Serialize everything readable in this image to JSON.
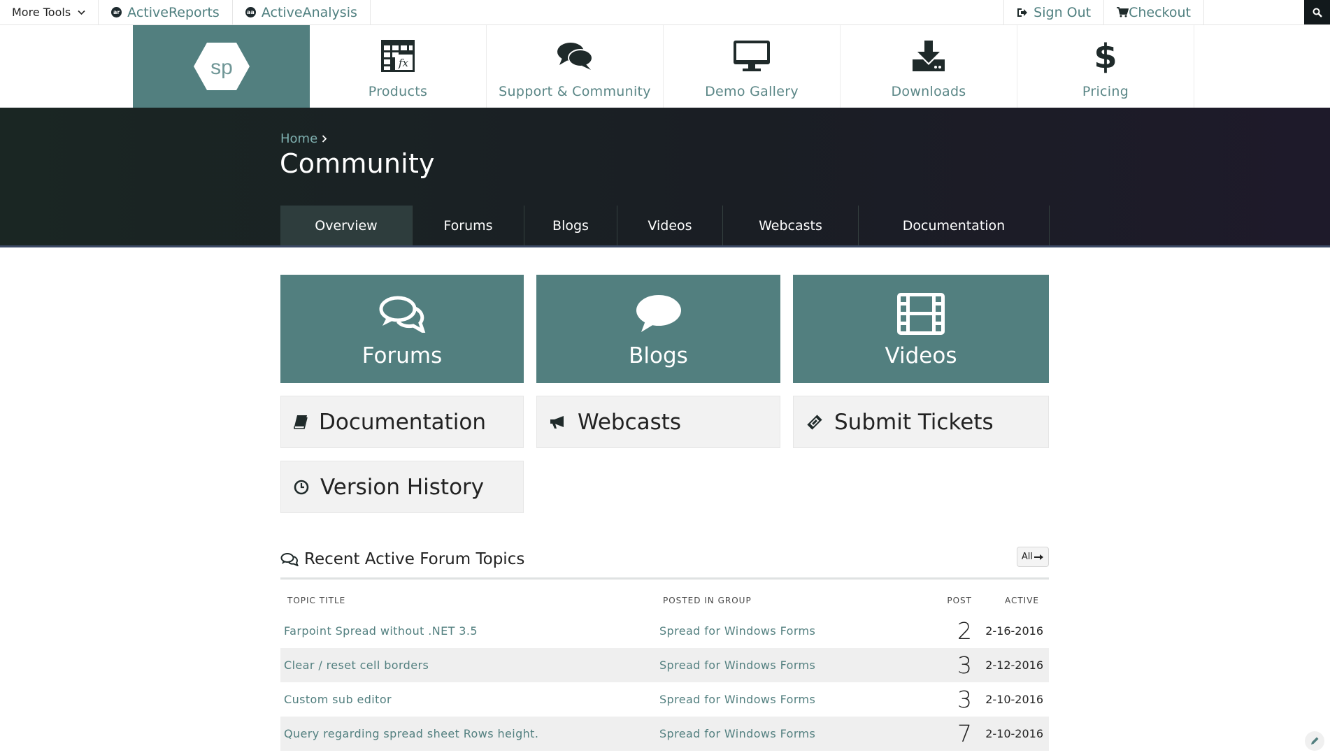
{
  "topbar": {
    "more_tools": "More Tools",
    "active_reports": "ActiveReports",
    "active_reports_badge": "ar",
    "active_analysis": "ActiveAnalysis",
    "active_analysis_badge": "aa",
    "sign_out": "Sign Out",
    "checkout": "Checkout"
  },
  "brand": {
    "logo_text": "sp"
  },
  "mainnav": [
    {
      "label": "Products",
      "icon": "spreadsheet-formula-icon"
    },
    {
      "label": "Support & Community",
      "icon": "chat-bubbles-icon"
    },
    {
      "label": "Demo Gallery",
      "icon": "monitor-icon"
    },
    {
      "label": "Downloads",
      "icon": "download-icon"
    },
    {
      "label": "Pricing",
      "icon": "dollar-icon"
    }
  ],
  "hero": {
    "breadcrumb_home": "Home",
    "title": "Community"
  },
  "subnav": [
    {
      "label": "Overview",
      "active": true
    },
    {
      "label": "Forums"
    },
    {
      "label": "Blogs"
    },
    {
      "label": "Videos"
    },
    {
      "label": "Webcasts"
    },
    {
      "label": "Documentation"
    }
  ],
  "tiles": [
    {
      "label": "Forums",
      "icon": "chat-bubbles-icon"
    },
    {
      "label": "Blogs",
      "icon": "speech-bubble-icon"
    },
    {
      "label": "Videos",
      "icon": "film-strip-icon"
    }
  ],
  "links": [
    {
      "label": "Documentation",
      "icon": "book-icon"
    },
    {
      "label": "Webcasts",
      "icon": "megaphone-icon"
    },
    {
      "label": "Submit Tickets",
      "icon": "ticket-icon"
    },
    {
      "label": "Version History",
      "icon": "clock-icon"
    }
  ],
  "forum": {
    "title": "Recent Active Forum Topics",
    "all_label": "All",
    "columns": [
      "TOPIC TITLE",
      "POSTED IN GROUP",
      "POST",
      "ACTIVE"
    ],
    "rows": [
      {
        "title": "Farpoint Spread without .NET 3.5",
        "group": "Spread for Windows Forms",
        "post": "2",
        "active": "2-16-2016"
      },
      {
        "title": "Clear / reset cell borders",
        "group": "Spread for Windows Forms",
        "post": "3",
        "active": "2-12-2016"
      },
      {
        "title": "Custom sub editor",
        "group": "Spread for Windows Forms",
        "post": "3",
        "active": "2-10-2016"
      },
      {
        "title": "Query regarding spread sheet Rows height.",
        "group": "Spread for Windows Forms",
        "post": "7",
        "active": "2-10-2016"
      }
    ]
  },
  "colors": {
    "accent": "#527f7f",
    "hero_bg": "#1a1e24",
    "link_text": "#527f7f"
  }
}
